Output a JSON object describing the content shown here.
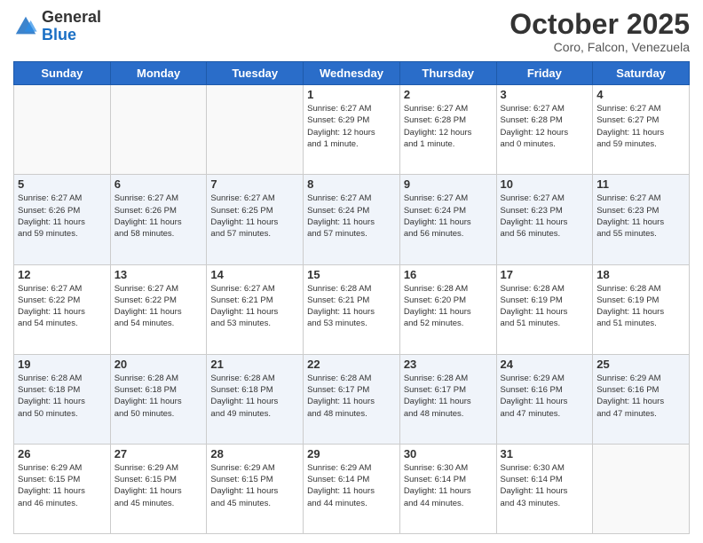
{
  "header": {
    "logo_general": "General",
    "logo_blue": "Blue",
    "month": "October 2025",
    "location": "Coro, Falcon, Venezuela"
  },
  "days_of_week": [
    "Sunday",
    "Monday",
    "Tuesday",
    "Wednesday",
    "Thursday",
    "Friday",
    "Saturday"
  ],
  "weeks": [
    {
      "shaded": false,
      "days": [
        {
          "num": "",
          "info": ""
        },
        {
          "num": "",
          "info": ""
        },
        {
          "num": "",
          "info": ""
        },
        {
          "num": "1",
          "info": "Sunrise: 6:27 AM\nSunset: 6:29 PM\nDaylight: 12 hours\nand 1 minute."
        },
        {
          "num": "2",
          "info": "Sunrise: 6:27 AM\nSunset: 6:28 PM\nDaylight: 12 hours\nand 1 minute."
        },
        {
          "num": "3",
          "info": "Sunrise: 6:27 AM\nSunset: 6:28 PM\nDaylight: 12 hours\nand 0 minutes."
        },
        {
          "num": "4",
          "info": "Sunrise: 6:27 AM\nSunset: 6:27 PM\nDaylight: 11 hours\nand 59 minutes."
        }
      ]
    },
    {
      "shaded": true,
      "days": [
        {
          "num": "5",
          "info": "Sunrise: 6:27 AM\nSunset: 6:26 PM\nDaylight: 11 hours\nand 59 minutes."
        },
        {
          "num": "6",
          "info": "Sunrise: 6:27 AM\nSunset: 6:26 PM\nDaylight: 11 hours\nand 58 minutes."
        },
        {
          "num": "7",
          "info": "Sunrise: 6:27 AM\nSunset: 6:25 PM\nDaylight: 11 hours\nand 57 minutes."
        },
        {
          "num": "8",
          "info": "Sunrise: 6:27 AM\nSunset: 6:24 PM\nDaylight: 11 hours\nand 57 minutes."
        },
        {
          "num": "9",
          "info": "Sunrise: 6:27 AM\nSunset: 6:24 PM\nDaylight: 11 hours\nand 56 minutes."
        },
        {
          "num": "10",
          "info": "Sunrise: 6:27 AM\nSunset: 6:23 PM\nDaylight: 11 hours\nand 56 minutes."
        },
        {
          "num": "11",
          "info": "Sunrise: 6:27 AM\nSunset: 6:23 PM\nDaylight: 11 hours\nand 55 minutes."
        }
      ]
    },
    {
      "shaded": false,
      "days": [
        {
          "num": "12",
          "info": "Sunrise: 6:27 AM\nSunset: 6:22 PM\nDaylight: 11 hours\nand 54 minutes."
        },
        {
          "num": "13",
          "info": "Sunrise: 6:27 AM\nSunset: 6:22 PM\nDaylight: 11 hours\nand 54 minutes."
        },
        {
          "num": "14",
          "info": "Sunrise: 6:27 AM\nSunset: 6:21 PM\nDaylight: 11 hours\nand 53 minutes."
        },
        {
          "num": "15",
          "info": "Sunrise: 6:28 AM\nSunset: 6:21 PM\nDaylight: 11 hours\nand 53 minutes."
        },
        {
          "num": "16",
          "info": "Sunrise: 6:28 AM\nSunset: 6:20 PM\nDaylight: 11 hours\nand 52 minutes."
        },
        {
          "num": "17",
          "info": "Sunrise: 6:28 AM\nSunset: 6:19 PM\nDaylight: 11 hours\nand 51 minutes."
        },
        {
          "num": "18",
          "info": "Sunrise: 6:28 AM\nSunset: 6:19 PM\nDaylight: 11 hours\nand 51 minutes."
        }
      ]
    },
    {
      "shaded": true,
      "days": [
        {
          "num": "19",
          "info": "Sunrise: 6:28 AM\nSunset: 6:18 PM\nDaylight: 11 hours\nand 50 minutes."
        },
        {
          "num": "20",
          "info": "Sunrise: 6:28 AM\nSunset: 6:18 PM\nDaylight: 11 hours\nand 50 minutes."
        },
        {
          "num": "21",
          "info": "Sunrise: 6:28 AM\nSunset: 6:18 PM\nDaylight: 11 hours\nand 49 minutes."
        },
        {
          "num": "22",
          "info": "Sunrise: 6:28 AM\nSunset: 6:17 PM\nDaylight: 11 hours\nand 48 minutes."
        },
        {
          "num": "23",
          "info": "Sunrise: 6:28 AM\nSunset: 6:17 PM\nDaylight: 11 hours\nand 48 minutes."
        },
        {
          "num": "24",
          "info": "Sunrise: 6:29 AM\nSunset: 6:16 PM\nDaylight: 11 hours\nand 47 minutes."
        },
        {
          "num": "25",
          "info": "Sunrise: 6:29 AM\nSunset: 6:16 PM\nDaylight: 11 hours\nand 47 minutes."
        }
      ]
    },
    {
      "shaded": false,
      "days": [
        {
          "num": "26",
          "info": "Sunrise: 6:29 AM\nSunset: 6:15 PM\nDaylight: 11 hours\nand 46 minutes."
        },
        {
          "num": "27",
          "info": "Sunrise: 6:29 AM\nSunset: 6:15 PM\nDaylight: 11 hours\nand 45 minutes."
        },
        {
          "num": "28",
          "info": "Sunrise: 6:29 AM\nSunset: 6:15 PM\nDaylight: 11 hours\nand 45 minutes."
        },
        {
          "num": "29",
          "info": "Sunrise: 6:29 AM\nSunset: 6:14 PM\nDaylight: 11 hours\nand 44 minutes."
        },
        {
          "num": "30",
          "info": "Sunrise: 6:30 AM\nSunset: 6:14 PM\nDaylight: 11 hours\nand 44 minutes."
        },
        {
          "num": "31",
          "info": "Sunrise: 6:30 AM\nSunset: 6:14 PM\nDaylight: 11 hours\nand 43 minutes."
        },
        {
          "num": "",
          "info": ""
        }
      ]
    }
  ]
}
